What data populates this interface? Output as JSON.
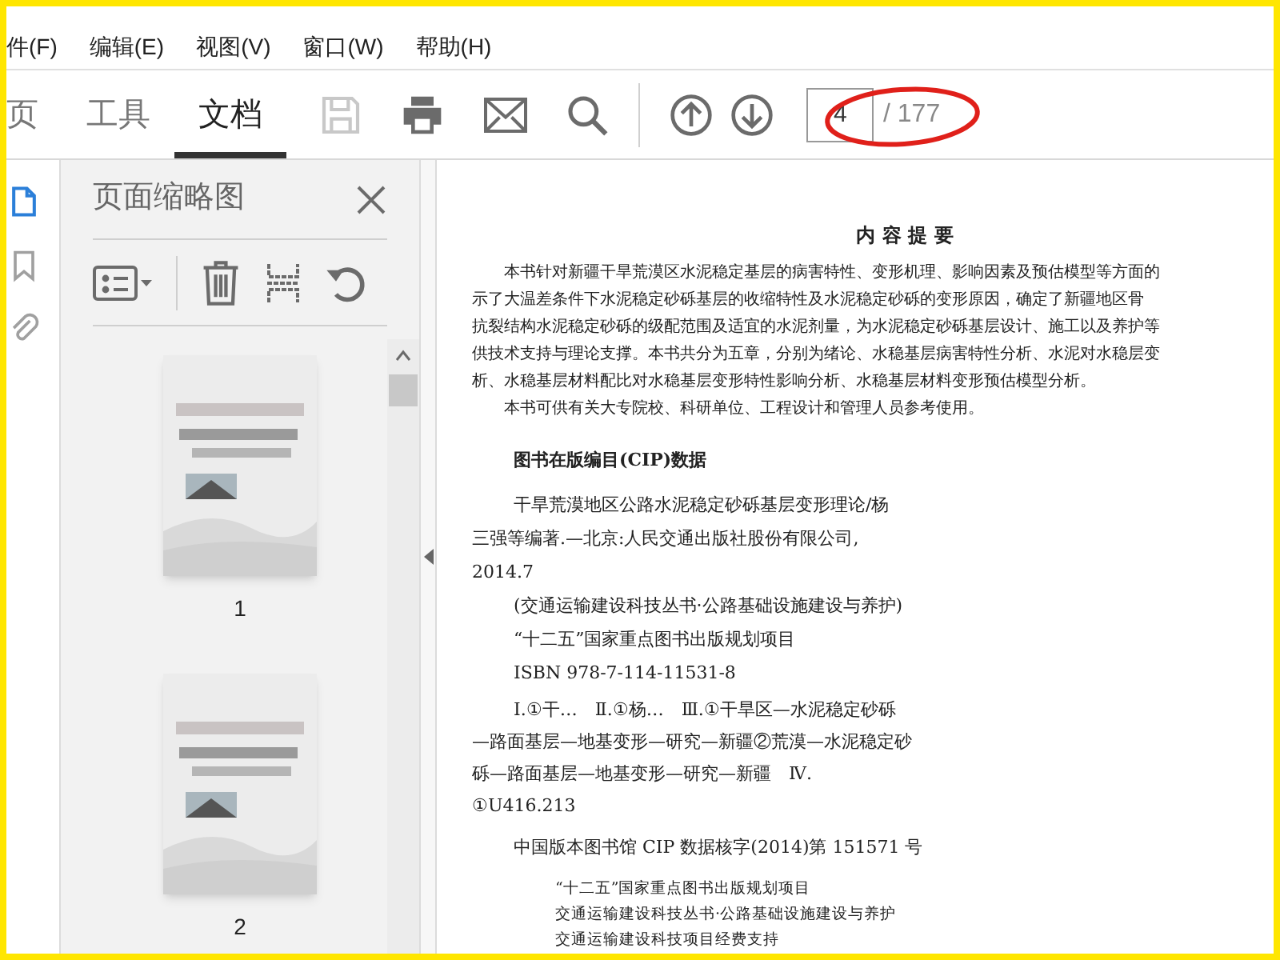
{
  "menu": [
    "件(F)",
    "编辑(E)",
    "视图(V)",
    "窗口(W)",
    "帮助(H)"
  ],
  "tabs": [
    {
      "label": "页",
      "selected": false
    },
    {
      "label": "工具",
      "selected": false
    },
    {
      "label": "文档",
      "selected": true
    }
  ],
  "toolbar": {
    "save_disabled": true,
    "page_input": "4",
    "page_total": "/ 177"
  },
  "side_icons": [
    {
      "kind": "pages",
      "selected": true
    },
    {
      "kind": "bookmark",
      "selected": false
    },
    {
      "kind": "attachment",
      "selected": false
    }
  ],
  "panel": {
    "title": "页面缩略图",
    "thumbnails": [
      {
        "kind": "picture",
        "label": "1"
      },
      {
        "kind": "picture",
        "label": "2"
      }
    ]
  },
  "document": {
    "heading": "内 容 提 要",
    "summary_lines": [
      "本书针对新疆干旱荒漠区水泥稳定基层的病害特性、变形机理、影响因素及预估模型等方面的",
      "示了大温差条件下水泥稳定砂砾基层的收缩特性及水泥稳定砂砾的变形原因，确定了新疆地区骨",
      "抗裂结构水泥稳定砂砾的级配范围及适宜的水泥剂量，为水泥稳定砂砾基层设计、施工以及养护等",
      "供技术支持与理论支撑。本书共分为五章，分别为绪论、水稳基层病害特性分析、水泥对水稳层变",
      "析、水稳基层材料配比对水稳基层变形特性影响分析、水稳基层材料变形预估模型分析。"
    ],
    "audience": "本书可供有关大专院校、科研单位、工程设计和管理人员参考使用。",
    "cip_heading": "图书在版编目(CIP)数据",
    "cip_lines": [
      {
        "text": "干旱荒漠地区公路水泥稳定砂砾基层变形理论/杨",
        "indent": true
      },
      {
        "text": "三强等编著.—北京:人民交通出版社股份有限公司,",
        "indent": false
      },
      {
        "text": "2014.7",
        "indent": false
      },
      {
        "text": "(交通运输建设科技丛书·公路基础设施建设与养护)",
        "indent": true
      },
      {
        "text": "“十二五”国家重点图书出版规划项目",
        "indent": true
      },
      {
        "text": "ISBN 978-7-114-11531-8",
        "indent": true
      }
    ],
    "class_lines": [
      {
        "text": "Ⅰ.①干…　Ⅱ.①杨…　Ⅲ.①干旱区—水泥稳定砂砾",
        "indent": true
      },
      {
        "text": "—路面基层—地基变形—研究—新疆②荒漠—水泥稳定砂",
        "indent": false
      },
      {
        "text": "砾—路面基层—地基变形—研究—新疆　Ⅳ.",
        "indent": false
      },
      {
        "text": "①U416.213",
        "indent": false
      }
    ],
    "cip_number": "中国版本图书馆 CIP 数据核字(2014)第 151571 号",
    "notes": [
      "“十二五”国家重点图书出版规划项目",
      "交通运输建设科技丛书·公路基础设施建设与养护",
      "交通运输建设科技项目经费支持"
    ]
  }
}
